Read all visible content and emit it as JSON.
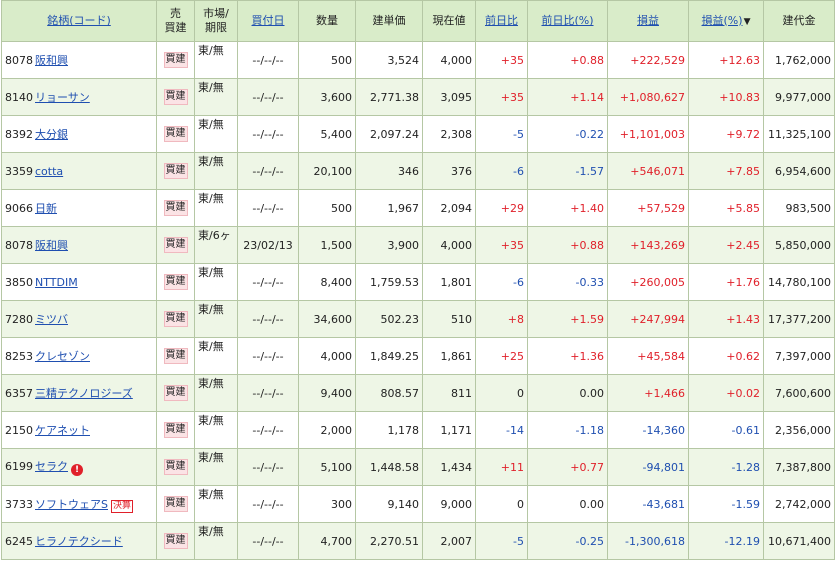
{
  "header": {
    "name_code": "銘柄(コード)",
    "side_line1": "売",
    "side_line2": "買建",
    "market_line1": "市場/",
    "market_line2": "期限",
    "buy_date": "買付日",
    "quantity": "数量",
    "unit_price": "建単価",
    "current_price": "現在値",
    "day_change": "前日比",
    "day_change_pct": "前日比(%)",
    "profit": "損益",
    "profit_pct": "損益(%)",
    "profit_pct_sort": "▼",
    "book_value": "建代金"
  },
  "rows": [
    {
      "code": "8078",
      "name": "阪和興",
      "side": "買建",
      "market": "東/無",
      "date": "--/--/--",
      "qty": "500",
      "unit": "3,524",
      "price": "4,000",
      "chg": "+35",
      "chg_pct": "+0.88",
      "pl": "+222,529",
      "pl_pct": "+12.63",
      "value": "1,762,000",
      "badge": ""
    },
    {
      "code": "8140",
      "name": "リョーサン",
      "side": "買建",
      "market": "東/無",
      "date": "--/--/--",
      "qty": "3,600",
      "unit": "2,771.38",
      "price": "3,095",
      "chg": "+35",
      "chg_pct": "+1.14",
      "pl": "+1,080,627",
      "pl_pct": "+10.83",
      "value": "9,977,000",
      "badge": ""
    },
    {
      "code": "8392",
      "name": "大分銀",
      "side": "買建",
      "market": "東/無",
      "date": "--/--/--",
      "qty": "5,400",
      "unit": "2,097.24",
      "price": "2,308",
      "chg": "-5",
      "chg_pct": "-0.22",
      "pl": "+1,101,003",
      "pl_pct": "+9.72",
      "value": "11,325,100",
      "badge": ""
    },
    {
      "code": "3359",
      "name": "cotta",
      "side": "買建",
      "market": "東/無",
      "date": "--/--/--",
      "qty": "20,100",
      "unit": "346",
      "price": "376",
      "chg": "-6",
      "chg_pct": "-1.57",
      "pl": "+546,071",
      "pl_pct": "+7.85",
      "value": "6,954,600",
      "badge": ""
    },
    {
      "code": "9066",
      "name": "日新",
      "side": "買建",
      "market": "東/無",
      "date": "--/--/--",
      "qty": "500",
      "unit": "1,967",
      "price": "2,094",
      "chg": "+29",
      "chg_pct": "+1.40",
      "pl": "+57,529",
      "pl_pct": "+5.85",
      "value": "983,500",
      "badge": ""
    },
    {
      "code": "8078",
      "name": "阪和興",
      "side": "買建",
      "market": "東/6ヶ",
      "date": "23/02/13",
      "qty": "1,500",
      "unit": "3,900",
      "price": "4,000",
      "chg": "+35",
      "chg_pct": "+0.88",
      "pl": "+143,269",
      "pl_pct": "+2.45",
      "value": "5,850,000",
      "badge": ""
    },
    {
      "code": "3850",
      "name": "NTTDIM",
      "side": "買建",
      "market": "東/無",
      "date": "--/--/--",
      "qty": "8,400",
      "unit": "1,759.53",
      "price": "1,801",
      "chg": "-6",
      "chg_pct": "-0.33",
      "pl": "+260,005",
      "pl_pct": "+1.76",
      "value": "14,780,100",
      "badge": ""
    },
    {
      "code": "7280",
      "name": "ミツバ",
      "side": "買建",
      "market": "東/無",
      "date": "--/--/--",
      "qty": "34,600",
      "unit": "502.23",
      "price": "510",
      "chg": "+8",
      "chg_pct": "+1.59",
      "pl": "+247,994",
      "pl_pct": "+1.43",
      "value": "17,377,200",
      "badge": ""
    },
    {
      "code": "8253",
      "name": "クレセゾン",
      "side": "買建",
      "market": "東/無",
      "date": "--/--/--",
      "qty": "4,000",
      "unit": "1,849.25",
      "price": "1,861",
      "chg": "+25",
      "chg_pct": "+1.36",
      "pl": "+45,584",
      "pl_pct": "+0.62",
      "value": "7,397,000",
      "badge": ""
    },
    {
      "code": "6357",
      "name": "三精テクノロジーズ",
      "side": "買建",
      "market": "東/無",
      "date": "--/--/--",
      "qty": "9,400",
      "unit": "808.57",
      "price": "811",
      "chg": "0",
      "chg_pct": "0.00",
      "pl": "+1,466",
      "pl_pct": "+0.02",
      "value": "7,600,600",
      "badge": ""
    },
    {
      "code": "2150",
      "name": "ケアネット",
      "side": "買建",
      "market": "東/無",
      "date": "--/--/--",
      "qty": "2,000",
      "unit": "1,178",
      "price": "1,171",
      "chg": "-14",
      "chg_pct": "-1.18",
      "pl": "-14,360",
      "pl_pct": "-0.61",
      "value": "2,356,000",
      "badge": ""
    },
    {
      "code": "6199",
      "name": "セラク",
      "side": "買建",
      "market": "東/無",
      "date": "--/--/--",
      "qty": "5,100",
      "unit": "1,448.58",
      "price": "1,434",
      "chg": "+11",
      "chg_pct": "+0.77",
      "pl": "-94,801",
      "pl_pct": "-1.28",
      "value": "7,387,800",
      "badge": "warn"
    },
    {
      "code": "3733",
      "name": "ソフトウェアS",
      "side": "買建",
      "market": "東/無",
      "date": "--/--/--",
      "qty": "300",
      "unit": "9,140",
      "price": "9,000",
      "chg": "0",
      "chg_pct": "0.00",
      "pl": "-43,681",
      "pl_pct": "-1.59",
      "value": "2,742,000",
      "badge": "kessan"
    },
    {
      "code": "6245",
      "name": "ヒラノテクシード",
      "side": "買建",
      "market": "東/無",
      "date": "--/--/--",
      "qty": "4,700",
      "unit": "2,270.51",
      "price": "2,007",
      "chg": "-5",
      "chg_pct": "-0.25",
      "pl": "-1,300,618",
      "pl_pct": "-12.19",
      "value": "10,671,400",
      "badge": ""
    }
  ],
  "badges": {
    "warn_glyph": "!",
    "kessan_label": "決算"
  },
  "colors": {
    "positive": "#e0202a",
    "negative": "#1f4fb0",
    "header_bg": "#d9ecc9",
    "row_alt_bg": "#eef6e6"
  }
}
